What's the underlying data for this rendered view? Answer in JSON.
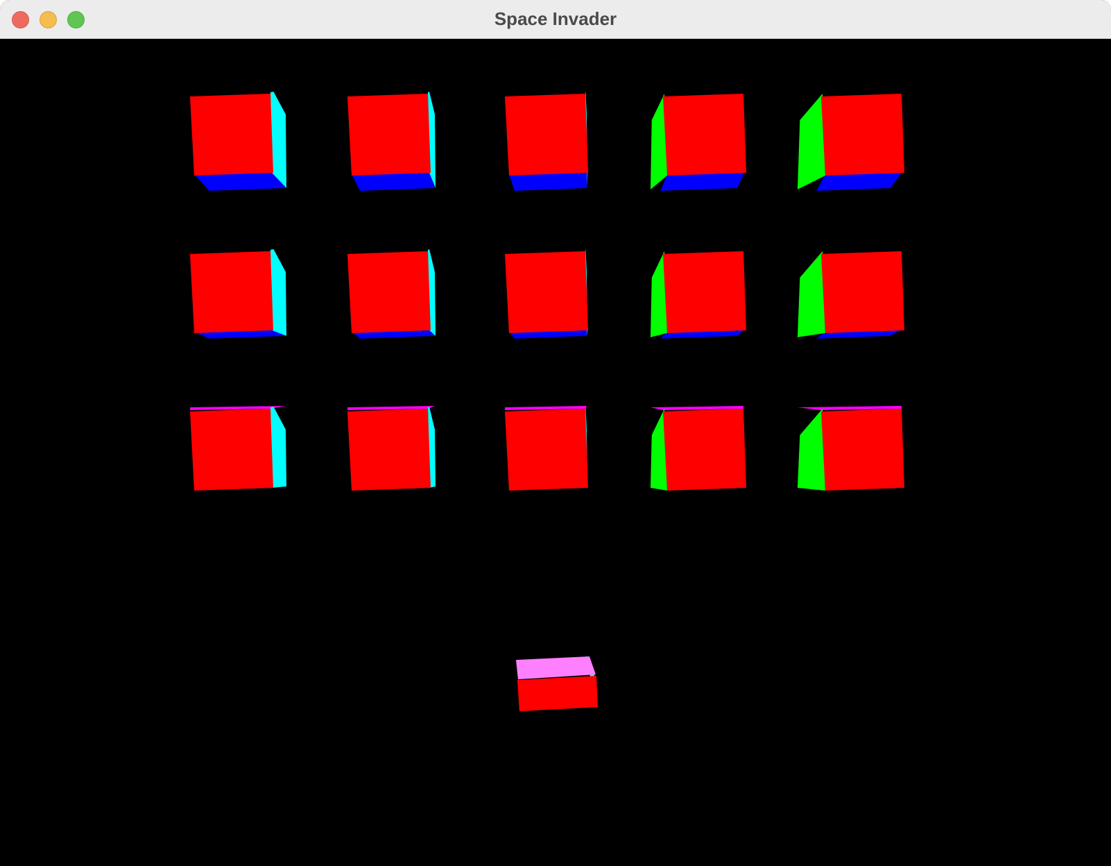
{
  "window": {
    "title": "Space Invader",
    "buttons": [
      {
        "name": "close",
        "color": "#ee6a5f"
      },
      {
        "name": "minimize",
        "color": "#f5bd4f"
      },
      {
        "name": "zoom",
        "color": "#61c554"
      }
    ]
  },
  "scene": {
    "background": "#000000",
    "face_colors": {
      "front": "#ff0000",
      "right": "#00ffff",
      "left": "#00ff00",
      "bottom": "#0000ff",
      "top": "#ff00ff",
      "player_top": "#ff80ff"
    },
    "invaders": {
      "rows": 3,
      "columns": 5,
      "count": 15
    },
    "player": {
      "count": 1
    }
  }
}
